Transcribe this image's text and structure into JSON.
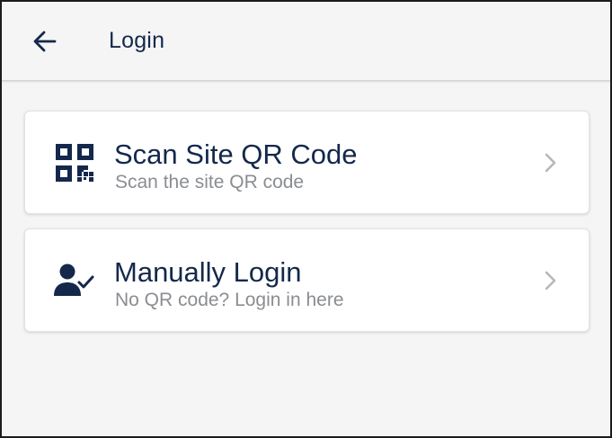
{
  "header": {
    "back_icon": "arrow-left-icon",
    "title": "Login"
  },
  "options": [
    {
      "icon": "qr-code-icon",
      "title": "Scan Site QR Code",
      "subtitle": "Scan the site QR code"
    },
    {
      "icon": "user-check-icon",
      "title": "Manually Login",
      "subtitle": "No QR code? Login in here"
    }
  ],
  "colors": {
    "primary": "#14284b",
    "subtitle": "#8a8d91",
    "chevron": "#b8b8b8",
    "background": "#f5f5f5",
    "card": "#ffffff"
  }
}
